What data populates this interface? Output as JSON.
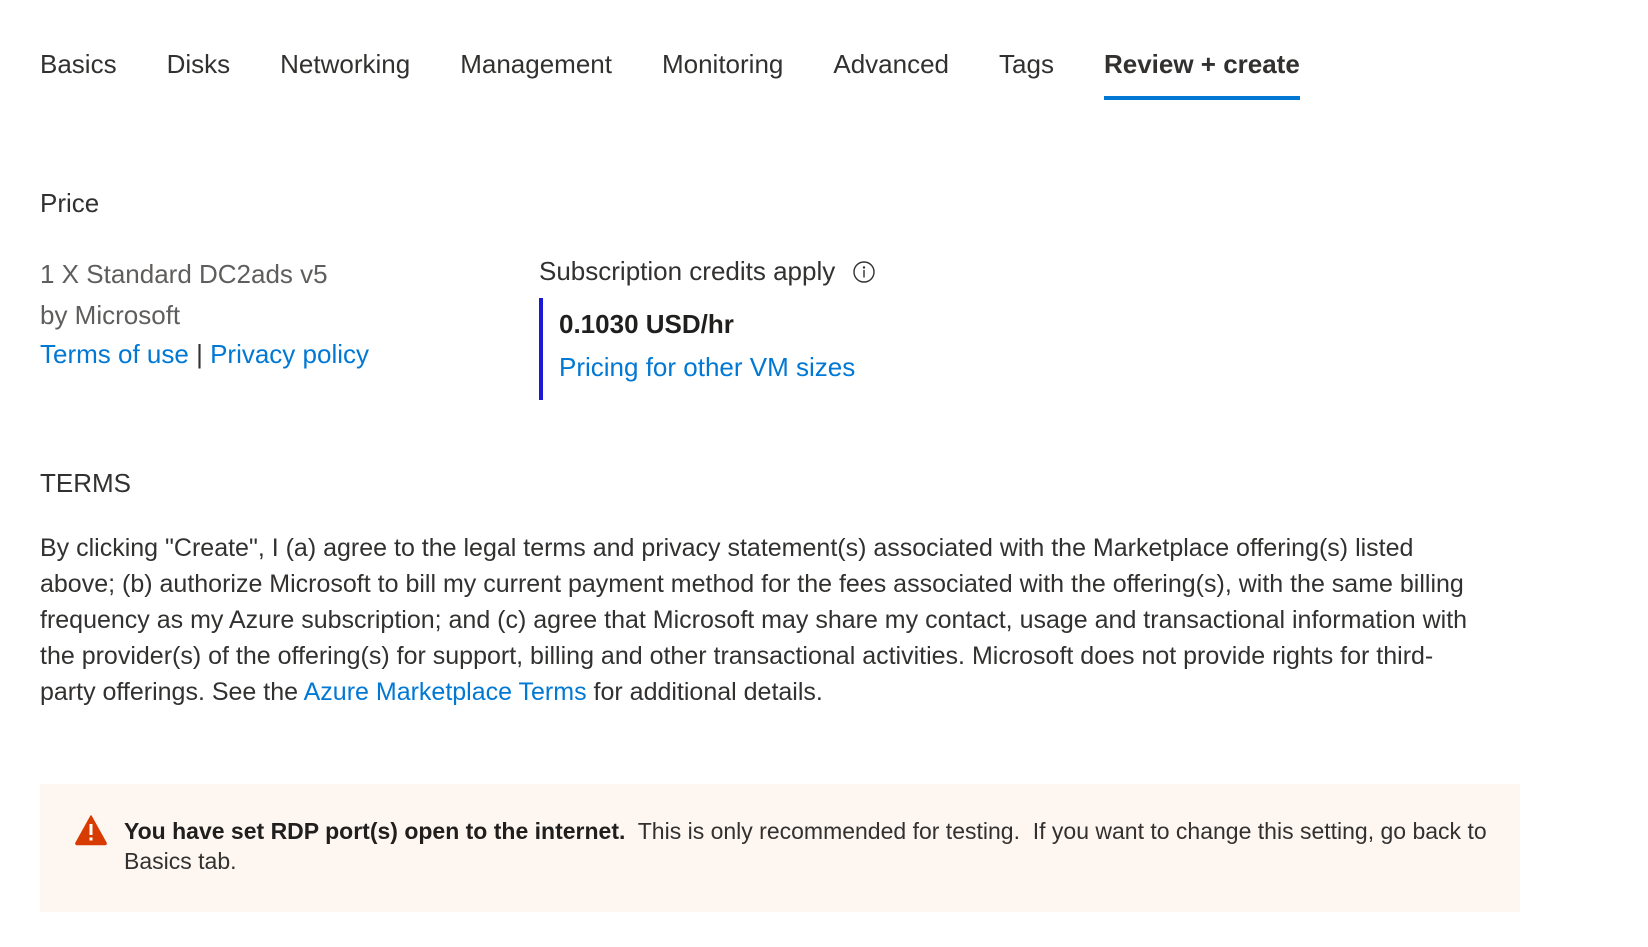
{
  "tabs": [
    {
      "label": "Basics",
      "active": false
    },
    {
      "label": "Disks",
      "active": false
    },
    {
      "label": "Networking",
      "active": false
    },
    {
      "label": "Management",
      "active": false
    },
    {
      "label": "Monitoring",
      "active": false
    },
    {
      "label": "Advanced",
      "active": false
    },
    {
      "label": "Tags",
      "active": false
    },
    {
      "label": "Review + create",
      "active": true
    }
  ],
  "price": {
    "section_title": "Price",
    "product_name": "1 X Standard DC2ads v5",
    "publisher": "by Microsoft",
    "terms_link": "Terms of use",
    "separator": "|",
    "privacy_link": "Privacy policy",
    "credits_label": "Subscription credits apply",
    "credits_icon": "info-icon",
    "rate": "0.1030 USD/hr",
    "pricing_link": "Pricing for other VM sizes"
  },
  "terms": {
    "section_title": "TERMS",
    "text_before_link": "By clicking \"Create\", I (a) agree to the legal terms and privacy statement(s) associated with the Marketplace offering(s) listed above; (b) authorize Microsoft to bill my current payment method for the fees associated with the offering(s), with the same billing frequency as my Azure subscription; and (c) agree that Microsoft may share my contact, usage and transactional information with the provider(s) of the offering(s) for support, billing and other transactional activities. Microsoft does not provide rights for third-party offerings. See the ",
    "link": "Azure Marketplace Terms",
    "text_after_link": " for additional details."
  },
  "warning": {
    "icon": "warning-icon",
    "bold_text": "You have set RDP port(s) open to the internet.",
    "text": "  This is only recommended for testing.  If you want to change this setting, go back to Basics tab."
  },
  "colors": {
    "accent": "#0078d4",
    "price_bar": "#1a1ad6",
    "warning_bg": "#fdf6f1",
    "warning_icon": "#d83b01"
  }
}
